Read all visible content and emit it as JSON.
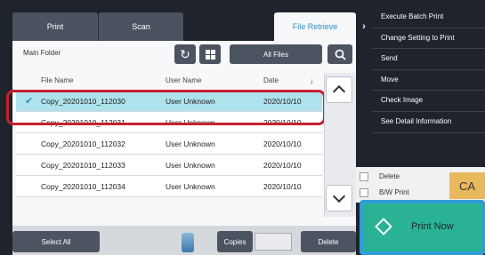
{
  "tabs": [
    {
      "label": "Print"
    },
    {
      "label": "Scan"
    },
    {
      "label": "File Retrieve"
    }
  ],
  "toolbar": {
    "folder_label": "Main Folder",
    "all_files_label": "All Files"
  },
  "table": {
    "headers": [
      "File Name",
      "User Name",
      "Date"
    ],
    "rows": [
      {
        "name": "Copy_20201010_112030",
        "user": "User Unknown",
        "date": "2020/10/10",
        "selected": true
      },
      {
        "name": "Copy_20201010_112031",
        "user": "User Unknown",
        "date": "2020/10/10"
      },
      {
        "name": "Copy_20201010_112032",
        "user": "User Unknown",
        "date": "2020/10/10"
      },
      {
        "name": "Copy_20201010_112033",
        "user": "User Unknown",
        "date": "2020/10/10"
      },
      {
        "name": "Copy_20201010_112034",
        "user": "User Unknown",
        "date": "2020/10/10"
      }
    ]
  },
  "bottom": {
    "select_all_label": "Select All",
    "copies_label": "Copies",
    "delete_label": "Delete"
  },
  "side_menu": {
    "items": [
      {
        "label": "Execute Batch Print"
      },
      {
        "label": "Change Setting to Print"
      },
      {
        "label": "Send"
      },
      {
        "label": "Move"
      },
      {
        "label": "Check Image"
      },
      {
        "label": "See Detail Information"
      }
    ]
  },
  "options": {
    "delete_label": "Delete",
    "bw_print_label": "B/W Print"
  },
  "ca_label": "CA",
  "print_now_label": "Print Now",
  "colors": {
    "accent": "#2f8fc2",
    "highlight": "#c8202e",
    "print_now": "#29b394",
    "ca": "#e8b85d"
  }
}
